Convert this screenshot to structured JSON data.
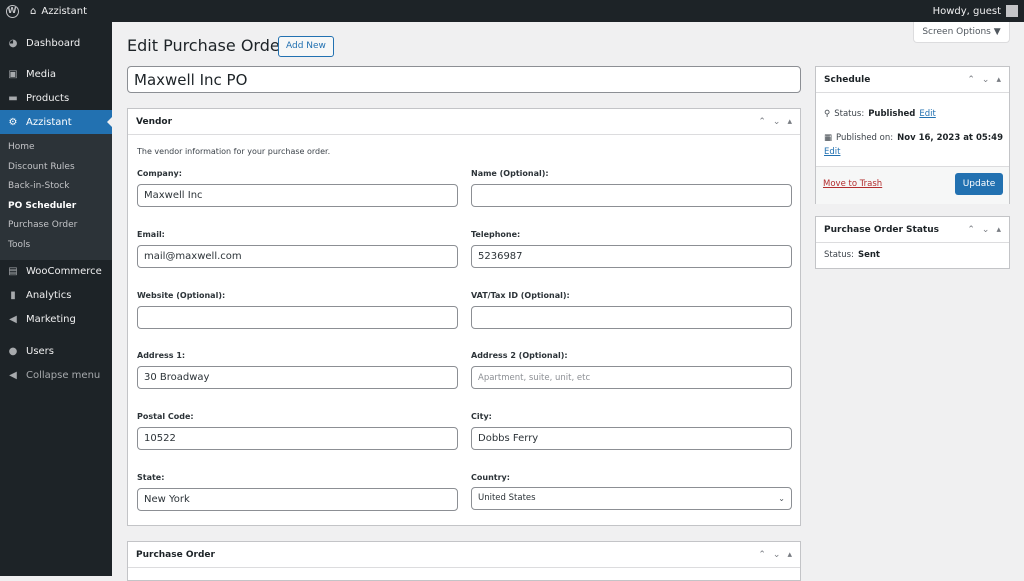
{
  "adminbar": {
    "site": "Azzistant",
    "greeting": "Howdy, guest"
  },
  "sidebar": {
    "items": [
      {
        "label": "Dashboard",
        "icon": "dashboard-icon"
      },
      {
        "label": "Media",
        "icon": "media-icon"
      },
      {
        "label": "Products",
        "icon": "products-icon"
      },
      {
        "label": "Azzistant",
        "icon": "gear-icon"
      }
    ],
    "submenu": [
      "Home",
      "Discount Rules",
      "Back-in-Stock",
      "PO Scheduler",
      "Purchase Order",
      "Tools"
    ],
    "items2": [
      {
        "label": "WooCommerce",
        "icon": "woo-icon"
      },
      {
        "label": "Analytics",
        "icon": "analytics-icon"
      },
      {
        "label": "Marketing",
        "icon": "megaphone-icon"
      },
      {
        "label": "Users",
        "icon": "user-icon"
      }
    ],
    "collapse": "Collapse menu"
  },
  "header": {
    "title": "Edit Purchase Order",
    "add_new": "Add New",
    "screen_options": "Screen Options ▼"
  },
  "post_title": "Maxwell Inc PO",
  "vendor": {
    "title": "Vendor",
    "description": "The vendor information for your purchase order.",
    "fields": {
      "company": {
        "label": "Company:",
        "value": "Maxwell Inc"
      },
      "name": {
        "label": "Name (Optional):",
        "value": ""
      },
      "email": {
        "label": "Email:",
        "value": "mail@maxwell.com"
      },
      "telephone": {
        "label": "Telephone:",
        "value": "5236987"
      },
      "website": {
        "label": "Website (Optional):",
        "value": ""
      },
      "vat": {
        "label": "VAT/Tax ID (Optional):",
        "value": ""
      },
      "address1": {
        "label": "Address 1:",
        "value": "30 Broadway"
      },
      "address2": {
        "label": "Address 2 (Optional):",
        "value": "",
        "placeholder": "Apartment, suite, unit, etc"
      },
      "postal": {
        "label": "Postal Code:",
        "value": "10522"
      },
      "city": {
        "label": "City:",
        "value": "Dobbs Ferry"
      },
      "state": {
        "label": "State:",
        "value": "New York"
      },
      "country": {
        "label": "Country:",
        "value": "United States"
      }
    }
  },
  "purchase_order": {
    "title": "Purchase Order"
  },
  "schedule": {
    "title": "Schedule",
    "status_label": "Status:",
    "status_value": "Published",
    "edit": "Edit",
    "published_label": "Published on:",
    "published_value": "Nov 16, 2023 at 05:49",
    "trash": "Move to Trash",
    "update": "Update"
  },
  "po_status": {
    "title": "Purchase Order Status",
    "label": "Status:",
    "value": "Sent"
  }
}
